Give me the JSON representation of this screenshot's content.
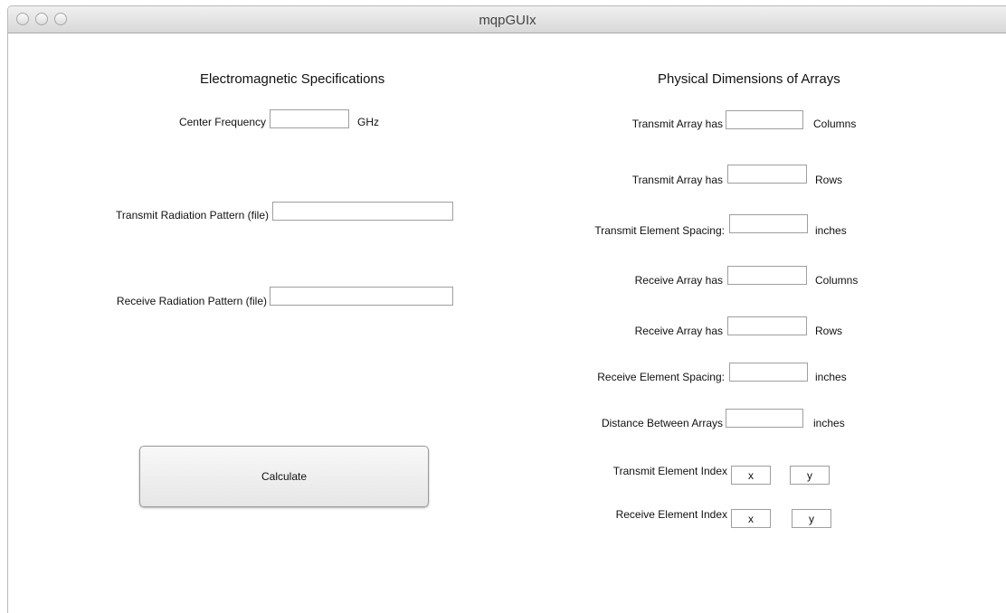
{
  "window": {
    "title": "mqpGUIx"
  },
  "left": {
    "heading": "Electromagnetic Specifications",
    "center_frequency": {
      "label": "Center Frequency",
      "value": "",
      "unit": "GHz"
    },
    "transmit_pattern": {
      "label": "Transmit Radiation Pattern (file)",
      "value": ""
    },
    "receive_pattern": {
      "label": "Receive Radiation Pattern (file)",
      "value": ""
    },
    "calculate_label": "Calculate"
  },
  "right": {
    "heading": "Physical Dimensions of Arrays",
    "tx_columns": {
      "label": "Transmit Array has",
      "value": "",
      "unit": "Columns"
    },
    "tx_rows": {
      "label": "Transmit Array has",
      "value": "",
      "unit": "Rows"
    },
    "tx_spacing": {
      "label": "Transmit Element Spacing:",
      "value": "",
      "unit": "inches"
    },
    "rx_columns": {
      "label": "Receive Array has",
      "value": "",
      "unit": "Columns"
    },
    "rx_rows": {
      "label": "Receive Array has",
      "value": "",
      "unit": "Rows"
    },
    "rx_spacing": {
      "label": "Receive Element Spacing:",
      "value": "",
      "unit": "inches"
    },
    "distance": {
      "label": "Distance Between Arrays",
      "value": "",
      "unit": "inches"
    },
    "tx_index": {
      "label": "Transmit Element Index",
      "x": "x",
      "y": "y"
    },
    "rx_index": {
      "label": "Receive Element Index",
      "x": "x",
      "y": "y"
    }
  }
}
